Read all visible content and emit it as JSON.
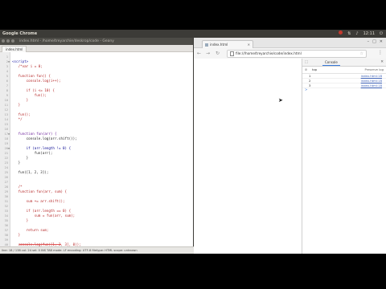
{
  "panel": {
    "app_name": "Google Chrome",
    "clock": "12:11"
  },
  "geany": {
    "title": "index.html - /home/treyarchie/deskrop/code - Geany",
    "tab": "index.html",
    "lines": [
      {
        "n": "1",
        "t": "",
        "c": "c-def"
      },
      {
        "n": "2",
        "t": "<script>",
        "c": "c-tag",
        "f": "⊟"
      },
      {
        "n": "3",
        "t": "   /*var i = 0;",
        "c": "c-com"
      },
      {
        "n": "4",
        "t": "",
        "c": "c-com"
      },
      {
        "n": "5",
        "t": "   function fun() {",
        "c": "c-com"
      },
      {
        "n": "6",
        "t": "       console.log(i++);",
        "c": "c-com"
      },
      {
        "n": "7",
        "t": "",
        "c": "c-com"
      },
      {
        "n": "8",
        "t": "       if (i <= 10) {",
        "c": "c-com"
      },
      {
        "n": "9",
        "t": "           fun();",
        "c": "c-com"
      },
      {
        "n": "10",
        "t": "       }",
        "c": "c-com"
      },
      {
        "n": "11",
        "t": "   }",
        "c": "c-com"
      },
      {
        "n": "12",
        "t": "",
        "c": "c-com"
      },
      {
        "n": "13",
        "t": "   fun();",
        "c": "c-com"
      },
      {
        "n": "14",
        "t": "   */",
        "c": "c-com"
      },
      {
        "n": "15",
        "t": "",
        "c": "c-def"
      },
      {
        "n": "16",
        "t": "",
        "c": "c-def"
      },
      {
        "n": "17",
        "t": "   function fun(arr) {",
        "c": "c-fn",
        "f": "⊟"
      },
      {
        "n": "18",
        "t": "       console.log(arr.shift());",
        "c": "c-def"
      },
      {
        "n": "19",
        "t": "",
        "c": "c-def"
      },
      {
        "n": "20",
        "t": "       if (arr.length != 0) {",
        "c": "c-kw",
        "f": "⊟"
      },
      {
        "n": "21",
        "t": "           fun(arr);",
        "c": "c-def"
      },
      {
        "n": "22",
        "t": "       }",
        "c": "c-def"
      },
      {
        "n": "23",
        "t": "   }",
        "c": "c-def"
      },
      {
        "n": "24",
        "t": "",
        "c": "c-def"
      },
      {
        "n": "25",
        "t": "   fun([1, 2, 3]);",
        "c": "c-def"
      },
      {
        "n": "26",
        "t": "",
        "c": "c-def"
      },
      {
        "n": "27",
        "t": "",
        "c": "c-def"
      },
      {
        "n": "28",
        "t": "   /*",
        "c": "c-com"
      },
      {
        "n": "29",
        "t": "   function fun(arr, sum) {",
        "c": "c-com"
      },
      {
        "n": "30",
        "t": "",
        "c": "c-com"
      },
      {
        "n": "31",
        "t": "       sum += arr.shift();",
        "c": "c-com"
      },
      {
        "n": "32",
        "t": "",
        "c": "c-com"
      },
      {
        "n": "33",
        "t": "       if (arr.length == 0) {",
        "c": "c-com"
      },
      {
        "n": "34",
        "t": "           sum = fun(arr, sum);",
        "c": "c-com"
      },
      {
        "n": "35",
        "t": "       }",
        "c": "c-com"
      },
      {
        "n": "36",
        "t": "",
        "c": "c-com"
      },
      {
        "n": "37",
        "t": "       return sum;",
        "c": "c-com"
      },
      {
        "n": "38",
        "t": "   }",
        "c": "c-com"
      },
      {
        "n": "39",
        "t": "",
        "c": "c-com"
      },
      {
        "n": "40",
        "t": "   console.log(fun([1, 2, 3], 0));",
        "c": "c-com"
      }
    ],
    "status": "line: 18 / 138    col: 24    sel: 0    INS    TAB    mode: LF    encoding: UTF-8    filetype: HTML    scope: unknown"
  },
  "chrome": {
    "tab_title": "index.html",
    "url": "file:///home/treyarchie/code/index.html",
    "devtools": {
      "tab": "Console",
      "context": "top",
      "preserve_log": "Preserve log",
      "rows": [
        {
          "value": "1",
          "source": "index.html:18"
        },
        {
          "value": "2",
          "source": "index.html:18"
        },
        {
          "value": "3",
          "source": "index.html:18"
        }
      ],
      "prompt": ">"
    }
  }
}
